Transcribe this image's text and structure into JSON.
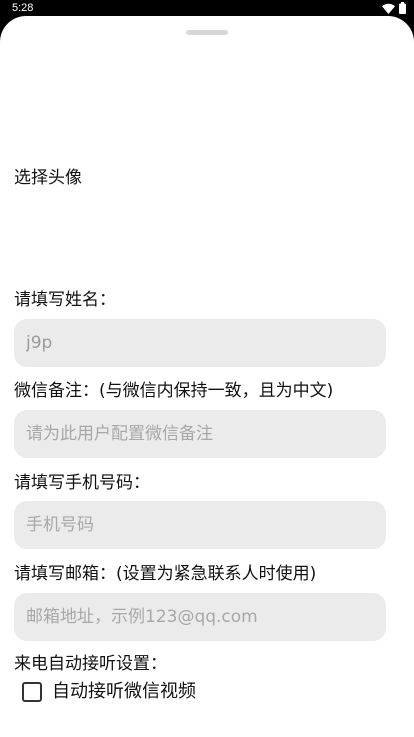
{
  "status_bar": {
    "time": "5:28"
  },
  "form": {
    "avatar_label": "选择头像",
    "name_label": "请填写姓名：",
    "name_value": "j9p",
    "wechat_note_label": "微信备注：(与微信内保持一致，且为中文)",
    "wechat_note_placeholder": "请为此用户配置微信备注",
    "phone_label": "请填写手机号码：",
    "phone_placeholder": "手机号码",
    "email_label": "请填写邮箱：(设置为紧急联系人时使用)",
    "email_placeholder": "邮箱地址，示例123@qq.com",
    "call_settings_label": "来电自动接听设置：",
    "auto_answer_label": "自动接听微信视频",
    "auto_answer_checked": false
  }
}
